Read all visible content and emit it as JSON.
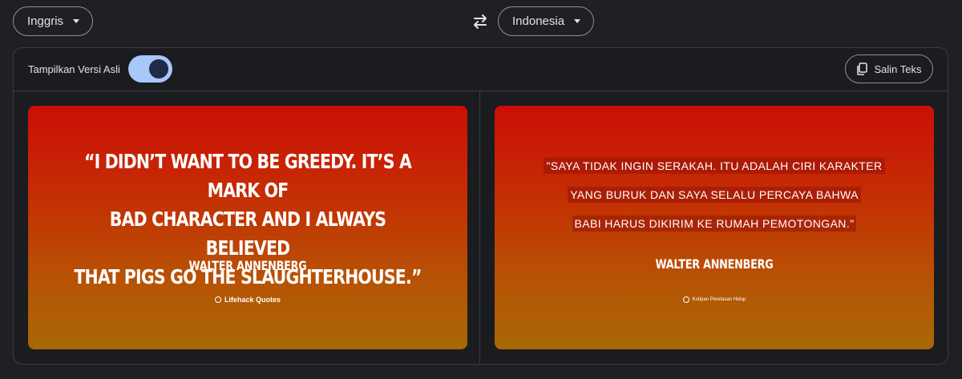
{
  "source_language": "Inggris",
  "target_language": "Indonesia",
  "toolbar": {
    "toggle_label": "Tampilkan Versi Asli",
    "toggle_on": true,
    "copy_label": "Salin Teks"
  },
  "original": {
    "quote_lines": [
      "“I DIDN’T WANT TO BE GREEDY. IT’S A MARK OF",
      "BAD CHARACTER AND I ALWAYS BELIEVED",
      "THAT PIGS GO THE SLAUGHTERHOUSE.”"
    ],
    "author": "WALTER ANNENBERG",
    "brand": "Lifehack Quotes"
  },
  "translated": {
    "quote_lines": [
      "\"SAYA TIDAK INGIN SERAKAH. ITU ADALAH CIRI KARAKTER",
      "YANG BURUK DAN SAYA SELALU PERCAYA BAHWA",
      "BABI HARUS DIKIRIM KE RUMAH PEMOTONGAN.\""
    ],
    "author": "WALTER ANNENBERG",
    "brand": "Kutipan Peretasan Hidup"
  },
  "colors": {
    "accent_toggle": "#a8c7fa",
    "card_top": "#cc0e06",
    "card_bottom": "#a76904"
  },
  "icons": [
    "chevron-down-icon",
    "swap-icon",
    "copy-icon"
  ]
}
